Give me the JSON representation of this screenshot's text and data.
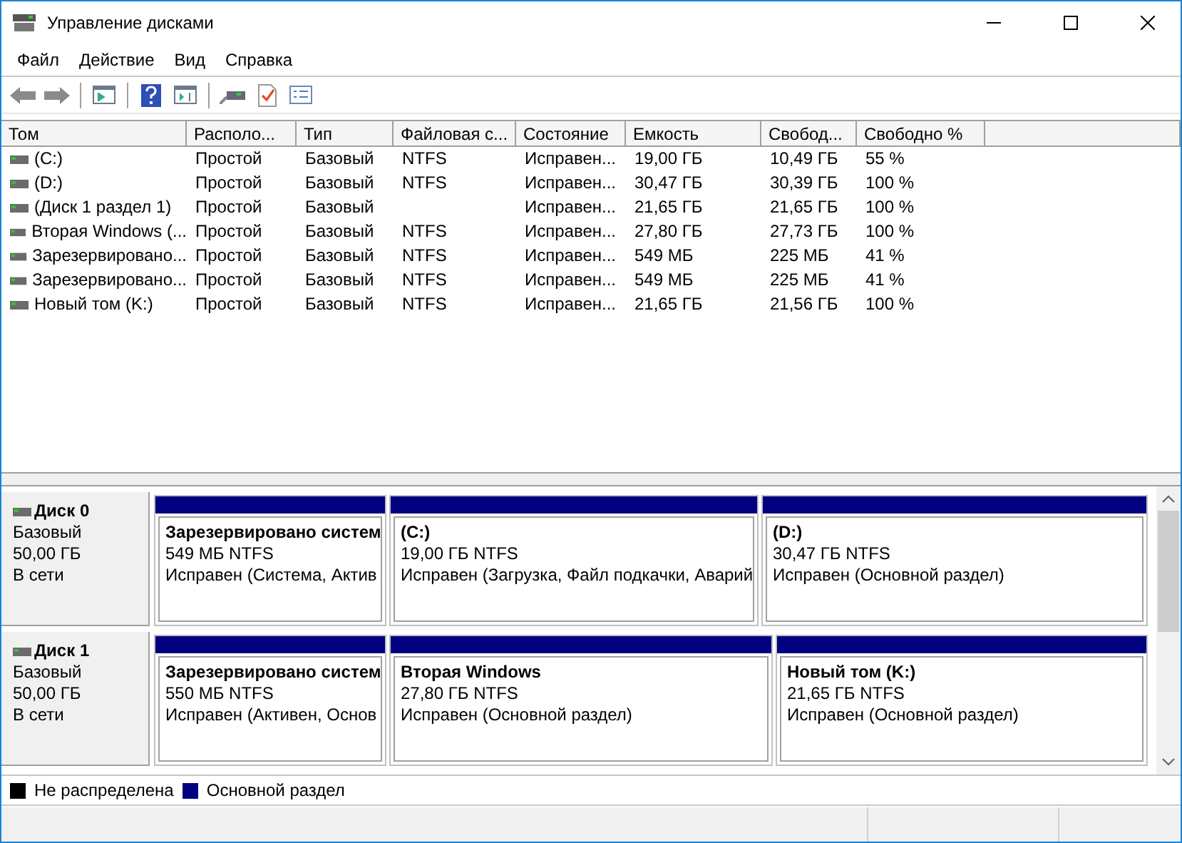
{
  "window": {
    "title": "Управление дисками"
  },
  "menu": [
    "Файл",
    "Действие",
    "Вид",
    "Справка"
  ],
  "table": {
    "columns": [
      "Том",
      "Располо...",
      "Тип",
      "Файловая с...",
      "Состояние",
      "Емкость",
      "Свобод...",
      "Свободно %"
    ],
    "rows": [
      {
        "cells": [
          "(C:)",
          "Простой",
          "Базовый",
          "NTFS",
          "Исправен...",
          "19,00 ГБ",
          "10,49 ГБ",
          "55 %"
        ]
      },
      {
        "cells": [
          "(D:)",
          "Простой",
          "Базовый",
          "NTFS",
          "Исправен...",
          "30,47 ГБ",
          "30,39 ГБ",
          "100 %"
        ]
      },
      {
        "cells": [
          "(Диск 1 раздел 1)",
          "Простой",
          "Базовый",
          "",
          "Исправен...",
          "21,65 ГБ",
          "21,65 ГБ",
          "100 %"
        ]
      },
      {
        "cells": [
          "Вторая Windows (...",
          "Простой",
          "Базовый",
          "NTFS",
          "Исправен...",
          "27,80 ГБ",
          "27,73 ГБ",
          "100 %"
        ]
      },
      {
        "cells": [
          "Зарезервировано...",
          "Простой",
          "Базовый",
          "NTFS",
          "Исправен...",
          "549 МБ",
          "225 МБ",
          "41 %"
        ]
      },
      {
        "cells": [
          "Зарезервировано...",
          "Простой",
          "Базовый",
          "NTFS",
          "Исправен...",
          "549 МБ",
          "225 МБ",
          "41 %"
        ]
      },
      {
        "cells": [
          "Новый том (K:)",
          "Простой",
          "Базовый",
          "NTFS",
          "Исправен...",
          "21,65 ГБ",
          "21,56 ГБ",
          "100 %"
        ]
      }
    ]
  },
  "disks": [
    {
      "name": "Диск 0",
      "type": "Базовый",
      "size": "50,00 ГБ",
      "status": "В сети",
      "partitions": [
        {
          "kind": "primary",
          "name": "Зарезервировано систем",
          "size": "549 МБ NTFS",
          "status": "Исправен (Система, Актив"
        },
        {
          "kind": "primary",
          "name": "(C:)",
          "size": "19,00 ГБ NTFS",
          "status": "Исправен (Загрузка, Файл подкачки, Аварий"
        },
        {
          "kind": "primary",
          "name": "(D:)",
          "size": "30,47 ГБ NTFS",
          "status": "Исправен (Основной раздел)"
        }
      ]
    },
    {
      "name": "Диск 1",
      "type": "Базовый",
      "size": "50,00 ГБ",
      "status": "В сети",
      "partitions": [
        {
          "kind": "primary",
          "name": "Зарезервировано систем",
          "size": "550 МБ NTFS",
          "status": "Исправен (Активен, Основ"
        },
        {
          "kind": "primary",
          "name": "Вторая Windows",
          "size": "27,80 ГБ NTFS",
          "status": "Исправен (Основной раздел)"
        },
        {
          "kind": "primary",
          "name": "Новый том  (K:)",
          "size": "21,65 ГБ NTFS",
          "status": "Исправен (Основной раздел)"
        }
      ]
    }
  ],
  "legend": [
    {
      "kind": "unallocated",
      "label": "Не распределена",
      "color": "#000000"
    },
    {
      "kind": "primary",
      "label": "Основной раздел",
      "color": "#000080"
    }
  ]
}
